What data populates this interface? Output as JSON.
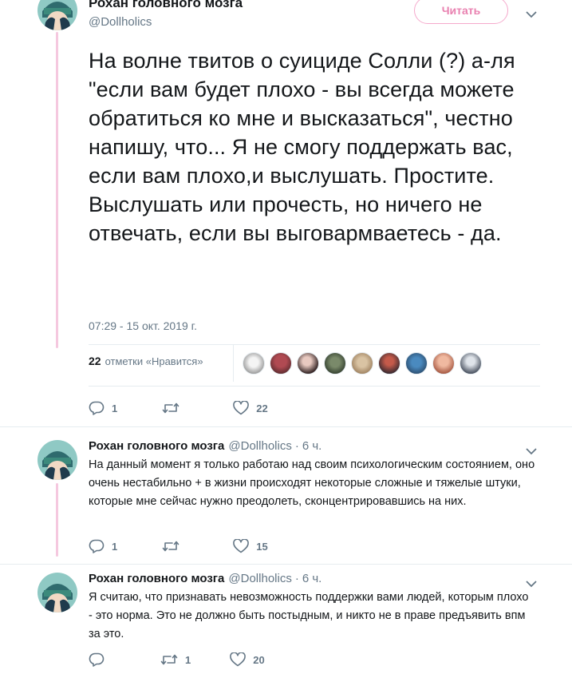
{
  "main_tweet": {
    "display_name": "Рохан головного мозга",
    "handle": "@Dollholics",
    "follow_label": "Читать",
    "text": "На волне твитов о суициде Солли (?) а-ля \"если вам будет плохо - вы всегда можете обратиться ко мне и высказаться\", честно напишу, что... Я не смогу поддержать вас, если вам плохо,и выслушать. Простите. Выслушать или прочесть, но ничего не отвечать, если вы выговармваетесь - да.",
    "timestamp": "07:29 - 15 окт. 2019 г.",
    "likes_count": "22",
    "likes_label": "отметки «Нравится»",
    "liker_avatar_count": 9,
    "reply_count": "1",
    "retweet_count": "",
    "like_count": "22"
  },
  "replies": [
    {
      "display_name": "Рохан головного мозга",
      "handle": "@Dollholics",
      "separator": "·",
      "time": "6 ч.",
      "text": "На данный момент я только работаю над своим психологическим состоянием, оно очень нестабильно + в жизни происходят некоторые сложные и тяжелые штуки, которые мне сейчас нужно преодолеть, сконцентрировавшись на них.",
      "reply_count": "1",
      "retweet_count": "",
      "like_count": "15"
    },
    {
      "display_name": "Рохан головного мозга",
      "handle": "@Dollholics",
      "separator": "·",
      "time": "6 ч.",
      "text": "Я считаю, что признавать невозможность поддержки вами людей, которым плохо - это норма. Это не должно быть постыдным, и никто не в праве предъявить впм за это.",
      "reply_count": "",
      "retweet_count": "1",
      "like_count": "20"
    }
  ],
  "icons": {
    "reply": "reply-icon",
    "retweet": "retweet-icon",
    "like": "heart-icon",
    "menu": "chevron-down-icon"
  },
  "colors": {
    "accent_pink": "#e981b0",
    "text_primary": "#14171a",
    "text_secondary": "#657786",
    "divider": "#e6ecf0"
  }
}
